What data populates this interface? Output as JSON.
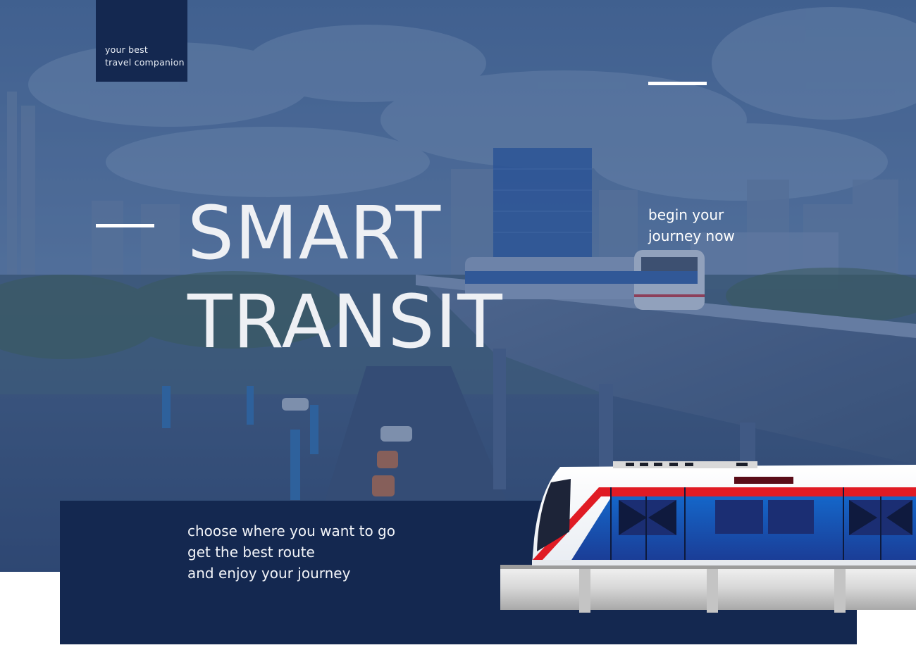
{
  "brand": {
    "tagline_line1": "your best",
    "tagline_line2": "travel companion"
  },
  "hero": {
    "title_line1": "SMART",
    "title_line2": "TRANSIT"
  },
  "cta": {
    "line1": "begin your",
    "line2": "journey now"
  },
  "info": {
    "line1": "choose where you want to go",
    "line2": "get the best route",
    "line3": "and enjoy your journey"
  },
  "colors": {
    "navy": "#142850",
    "overlay": "#2e4a78",
    "white": "#ffffff"
  },
  "images": {
    "background": "city skyline with elevated skytrain",
    "foreground": "skytrain car illustration"
  }
}
